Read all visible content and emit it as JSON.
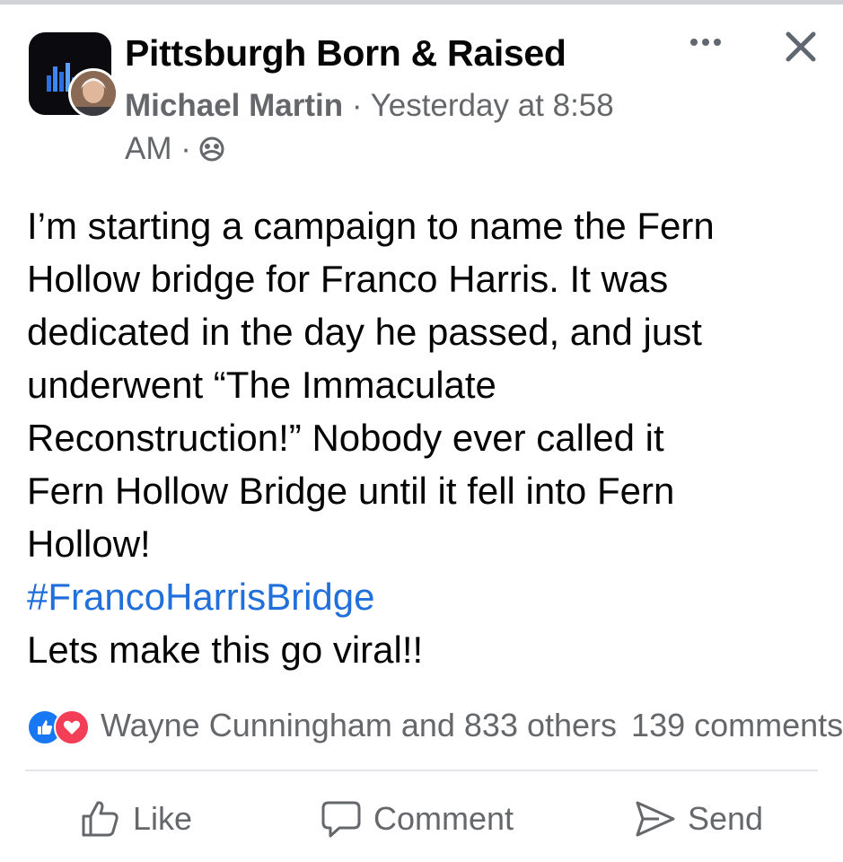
{
  "post": {
    "group_name": "Pittsburgh Born & Raised",
    "author": "Michael Martin",
    "time_line1": "· Yesterday at 8:58",
    "time_line2": "AM ·",
    "privacy_icon": "group-members-icon",
    "body_lines": [
      "I’m starting a campaign to name the Fern",
      "Hollow bridge for Franco Harris. It was",
      "dedicated in the day he passed, and just",
      "underwent “The Immaculate",
      "Reconstruction!” Nobody ever called it",
      "Fern Hollow Bridge until it fell into Fern",
      "Hollow!"
    ],
    "hashtag": "#FrancoHarrisBridge",
    "closing_line": "Lets make this go viral!!"
  },
  "reactions": {
    "icons": [
      "like-reaction-icon",
      "love-reaction-icon"
    ],
    "summary": "Wayne Cunningham and 833 others",
    "comments": "139 comments"
  },
  "actions": {
    "like_label": "Like",
    "comment_label": "Comment",
    "send_label": "Send"
  },
  "colors": {
    "hashtag": "#216fdb",
    "secondary_text": "#65676b",
    "like_blue": "#1877f2",
    "love_red": "#f33e58"
  }
}
